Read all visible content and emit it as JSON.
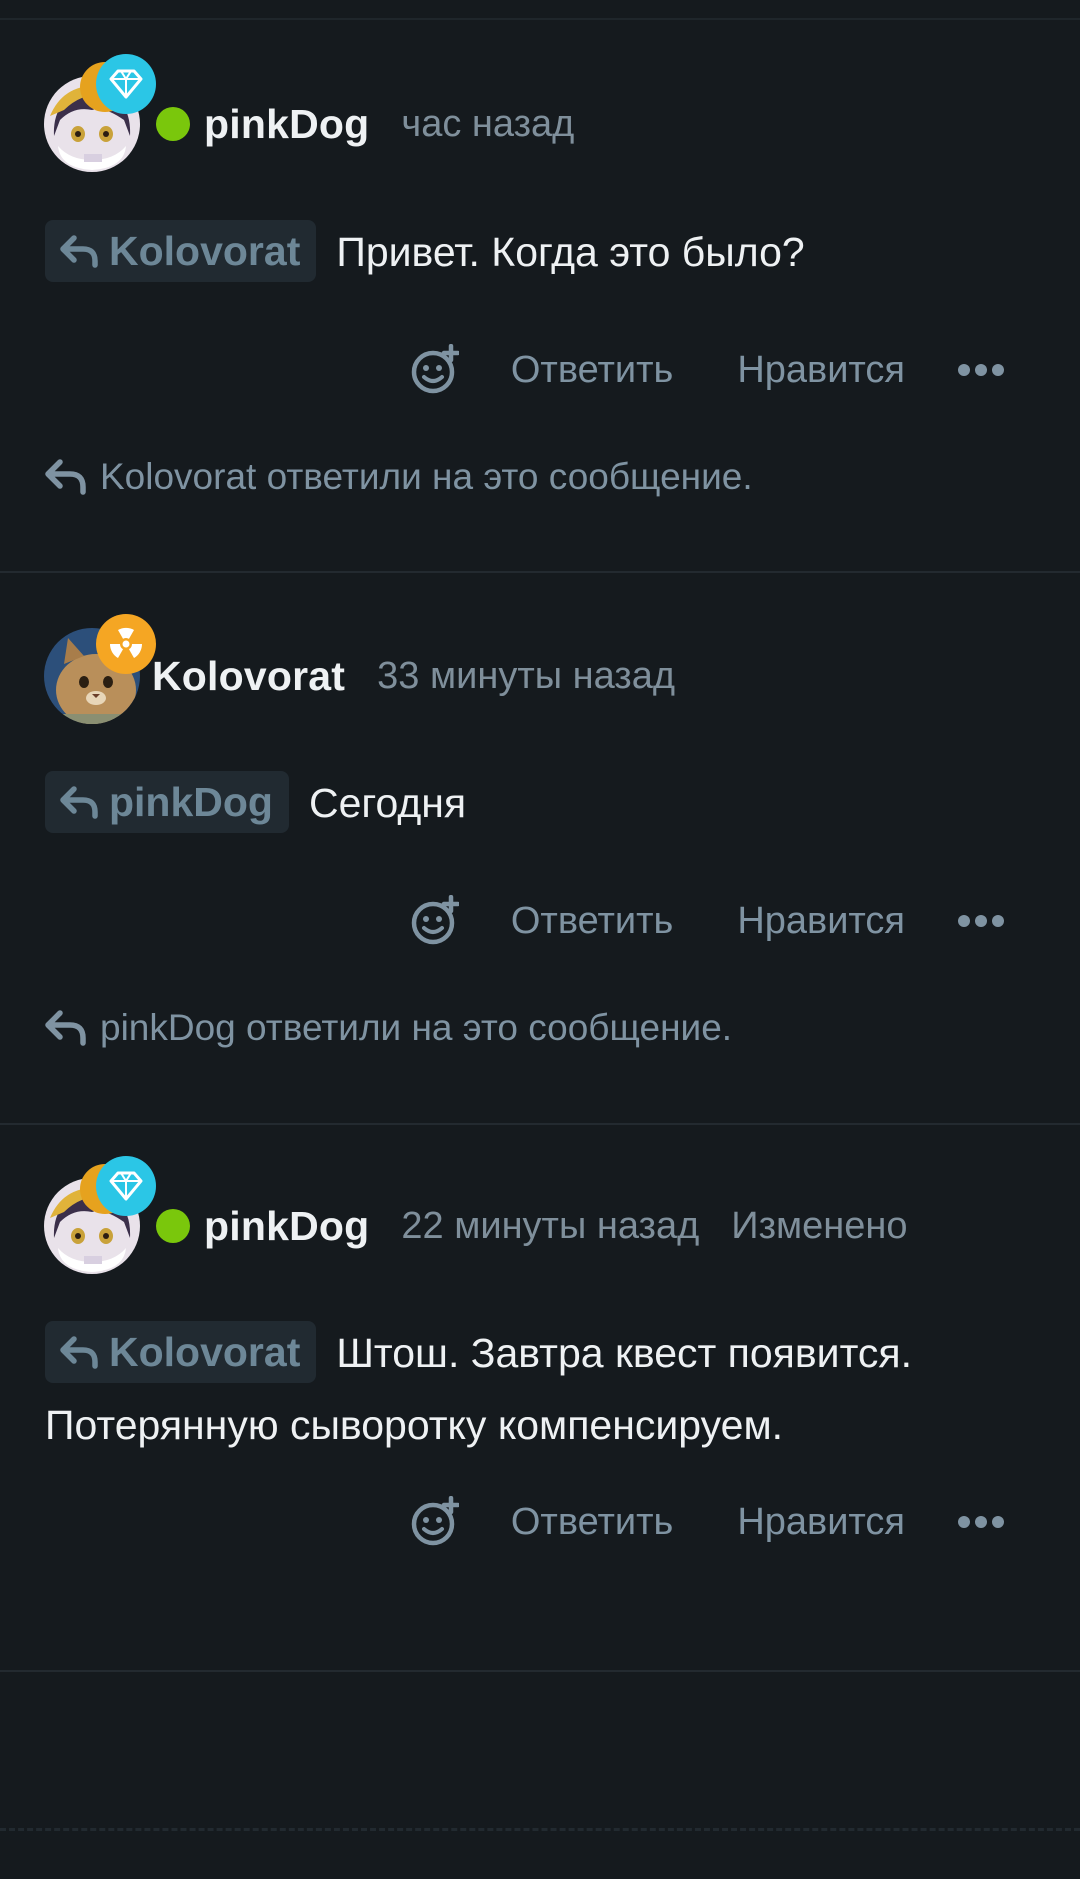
{
  "comments": [
    {
      "username": "pinkDog",
      "time": "час назад",
      "edited": "",
      "reply_to": "Kolovorat",
      "text": "Привет. Когда это было?",
      "actions": {
        "reply": "Ответить",
        "like": "Нравится"
      },
      "replied_note": "Kolovorat ответили на это сообщение."
    },
    {
      "username": "Kolovorat",
      "time": "33 минуты назад",
      "edited": "",
      "reply_to": "pinkDog",
      "text": "Сегодня",
      "actions": {
        "reply": "Ответить",
        "like": "Нравится"
      },
      "replied_note": "pinkDog ответили на это сообщение."
    },
    {
      "username": "pinkDog",
      "time": "22 минуты назад",
      "edited": "Изменено",
      "reply_to": "Kolovorat",
      "text": "Штош. Завтра квест появится. Потерянную сыворотку компенсируем.",
      "actions": {
        "reply": "Ответить",
        "like": "Нравится"
      }
    }
  ],
  "colors": {
    "background": "#151a1e",
    "online": "#7ac70c",
    "muted": "#7f93a2",
    "diamond_badge": "#2bc6e6",
    "radiation_badge": "#f5a623"
  },
  "icons": [
    "reply-arrow-icon",
    "add-reaction-icon",
    "more-options-icon",
    "diamond-badge-icon",
    "radiation-badge-icon"
  ]
}
